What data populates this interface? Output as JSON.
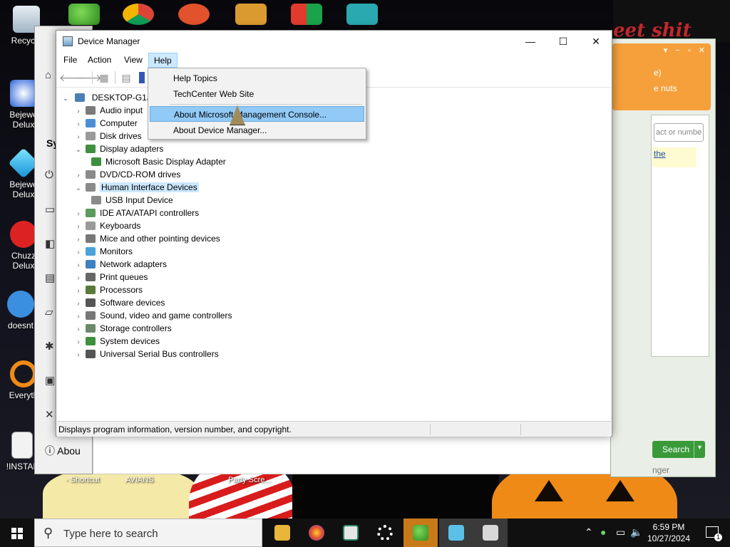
{
  "desktop": {
    "icons": [
      {
        "label": "Recycle"
      },
      {
        "label": "Bejewe Delux"
      },
      {
        "label": "Bejewe Delux"
      },
      {
        "label": "Chuzz Delux"
      },
      {
        "label": "doesnt"
      },
      {
        "label": "Everyth"
      },
      {
        "label": "!INSTAL"
      }
    ],
    "bottom_labels": [
      "- Shortcut",
      "AVIANS",
      "Party Scre..."
    ],
    "wallpaper_text": "eet shit"
  },
  "settings_window": {
    "section_label": "Sy",
    "about_label": "Abou"
  },
  "help_window": {
    "line1": "e)",
    "line2": "e nuts",
    "search_placeholder": "act or numbe",
    "link_text": "the",
    "search_button": "Search",
    "bottom_text": "nger"
  },
  "device_manager": {
    "title": "Device Manager",
    "menu": [
      "File",
      "Action",
      "View",
      "Help"
    ],
    "active_menu": "Help",
    "tree_root": "DESKTOP-G1JM",
    "tree": [
      {
        "label": "Audio input",
        "expanded": false
      },
      {
        "label": "Computer",
        "expanded": false
      },
      {
        "label": "Disk drives",
        "expanded": false
      },
      {
        "label": "Display adapters",
        "expanded": true
      },
      {
        "label": "Microsoft Basic Display Adapter",
        "child": true
      },
      {
        "label": "DVD/CD-ROM drives",
        "expanded": false
      },
      {
        "label": "Human Interface Devices",
        "expanded": true,
        "selected": true
      },
      {
        "label": "USB Input Device",
        "child": true
      },
      {
        "label": "IDE ATA/ATAPI controllers",
        "expanded": false
      },
      {
        "label": "Keyboards",
        "expanded": false
      },
      {
        "label": "Mice and other pointing devices",
        "expanded": false
      },
      {
        "label": "Monitors",
        "expanded": false
      },
      {
        "label": "Network adapters",
        "expanded": false
      },
      {
        "label": "Print queues",
        "expanded": false
      },
      {
        "label": "Processors",
        "expanded": false
      },
      {
        "label": "Software devices",
        "expanded": false
      },
      {
        "label": "Sound, video and game controllers",
        "expanded": false
      },
      {
        "label": "Storage controllers",
        "expanded": false
      },
      {
        "label": "System devices",
        "expanded": false
      },
      {
        "label": "Universal Serial Bus controllers",
        "expanded": false
      }
    ],
    "help_menu": {
      "items": [
        "Help Topics",
        "TechCenter Web Site",
        "About Microsoft Management Console...",
        "About Device Manager..."
      ],
      "highlighted": "About Microsoft Management Console..."
    },
    "status_text": "Displays program information, version number, and copyright."
  },
  "taskbar": {
    "search_placeholder": "Type here to search",
    "time": "6:59 PM",
    "date": "10/27/2024",
    "notifications": "1"
  },
  "colors": {
    "selection": "#cce8ff",
    "menu_highlight": "#91c9f7",
    "taskbar": "#101010"
  }
}
